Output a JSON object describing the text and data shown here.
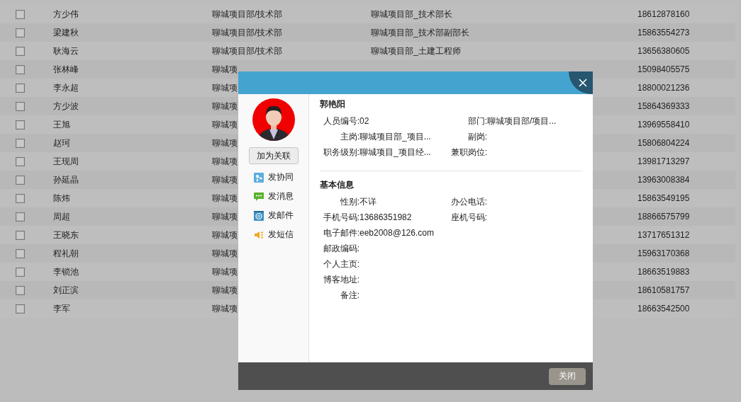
{
  "table": {
    "rows": [
      {
        "checked": false,
        "name": "方少伟",
        "department": "聊城项目部/技术部",
        "position": "聊城项目部_技术部长",
        "phone": "18612878160"
      },
      {
        "checked": false,
        "name": "梁建秋",
        "department": "聊城项目部/技术部",
        "position": "聊城项目部_技术部副部长",
        "phone": "15863554273"
      },
      {
        "checked": false,
        "name": "耿海云",
        "department": "聊城项目部/技术部",
        "position": "聊城项目部_土建工程师",
        "phone": "13656380605"
      },
      {
        "checked": false,
        "name": "张林峰",
        "department": "聊城项",
        "phone": "15098405575"
      },
      {
        "checked": false,
        "name": "李永超",
        "department": "聊城项",
        "phone": "18800021236"
      },
      {
        "checked": false,
        "name": "方少波",
        "department": "聊城项",
        "phone": "15864369333"
      },
      {
        "checked": false,
        "name": "王旭",
        "department": "聊城项",
        "phone": "13969558410"
      },
      {
        "checked": false,
        "name": "赵珂",
        "department": "聊城项",
        "phone": "15806804224"
      },
      {
        "checked": false,
        "name": "王现周",
        "department": "聊城项",
        "phone": "13981713297"
      },
      {
        "checked": false,
        "name": "孙延晶",
        "department": "聊城项",
        "phone": "13963008384"
      },
      {
        "checked": false,
        "name": "陈炜",
        "department": "聊城项",
        "phone": "15863549195"
      },
      {
        "checked": false,
        "name": "周超",
        "department": "聊城项",
        "phone": "18866575799"
      },
      {
        "checked": false,
        "name": "王晓东",
        "department": "聊城项",
        "phone": "13717651312"
      },
      {
        "checked": false,
        "name": "程礼朝",
        "department": "聊城项",
        "phone": "15963170368"
      },
      {
        "checked": false,
        "name": "李锁池",
        "department": "聊城项",
        "phone": "18663519883"
      },
      {
        "checked": false,
        "name": "刘正滨",
        "department": "聊城项",
        "phone": "18610581757"
      },
      {
        "checked": false,
        "name": "李军",
        "department": "聊城项",
        "phone": "18663542500"
      }
    ]
  },
  "dialog": {
    "relate_button": "加为关联",
    "actions": [
      {
        "kind": "collaborate",
        "label": "发协同"
      },
      {
        "kind": "message",
        "label": "发消息"
      },
      {
        "kind": "email",
        "label": "发邮件"
      },
      {
        "kind": "sms",
        "label": "发短信"
      }
    ],
    "sections": [
      {
        "title": "郭艳阳",
        "rows": [
          [
            {
              "label": "人员编号:",
              "value": "02"
            },
            {
              "label": "部门:",
              "value": "聊城项目部/项目..."
            }
          ],
          [
            {
              "label": "主岗:",
              "value": "聊城项目部_项目..."
            },
            {
              "label": "副岗:"
            }
          ],
          [
            {
              "label": "职务级别:",
              "value": "聊城项目_项目经..."
            },
            {
              "label": "兼职岗位:"
            }
          ]
        ]
      },
      {
        "title": "基本信息",
        "rows": [
          [
            {
              "label": "性别:",
              "value": "不详"
            },
            {
              "label": "办公电话:"
            }
          ],
          [
            {
              "label": "手机号码:",
              "value": "13686351982"
            },
            {
              "label": "座机号码:"
            }
          ],
          [
            {
              "label": "电子邮件:",
              "value": "eeb2008@126.com"
            }
          ],
          [
            {
              "label": "邮政编码:"
            }
          ],
          [
            {
              "label": "个人主页:"
            }
          ],
          [
            {
              "label": "博客地址:"
            }
          ],
          [
            {
              "label": "备注:"
            }
          ]
        ]
      }
    ],
    "close_button": "关闭"
  }
}
